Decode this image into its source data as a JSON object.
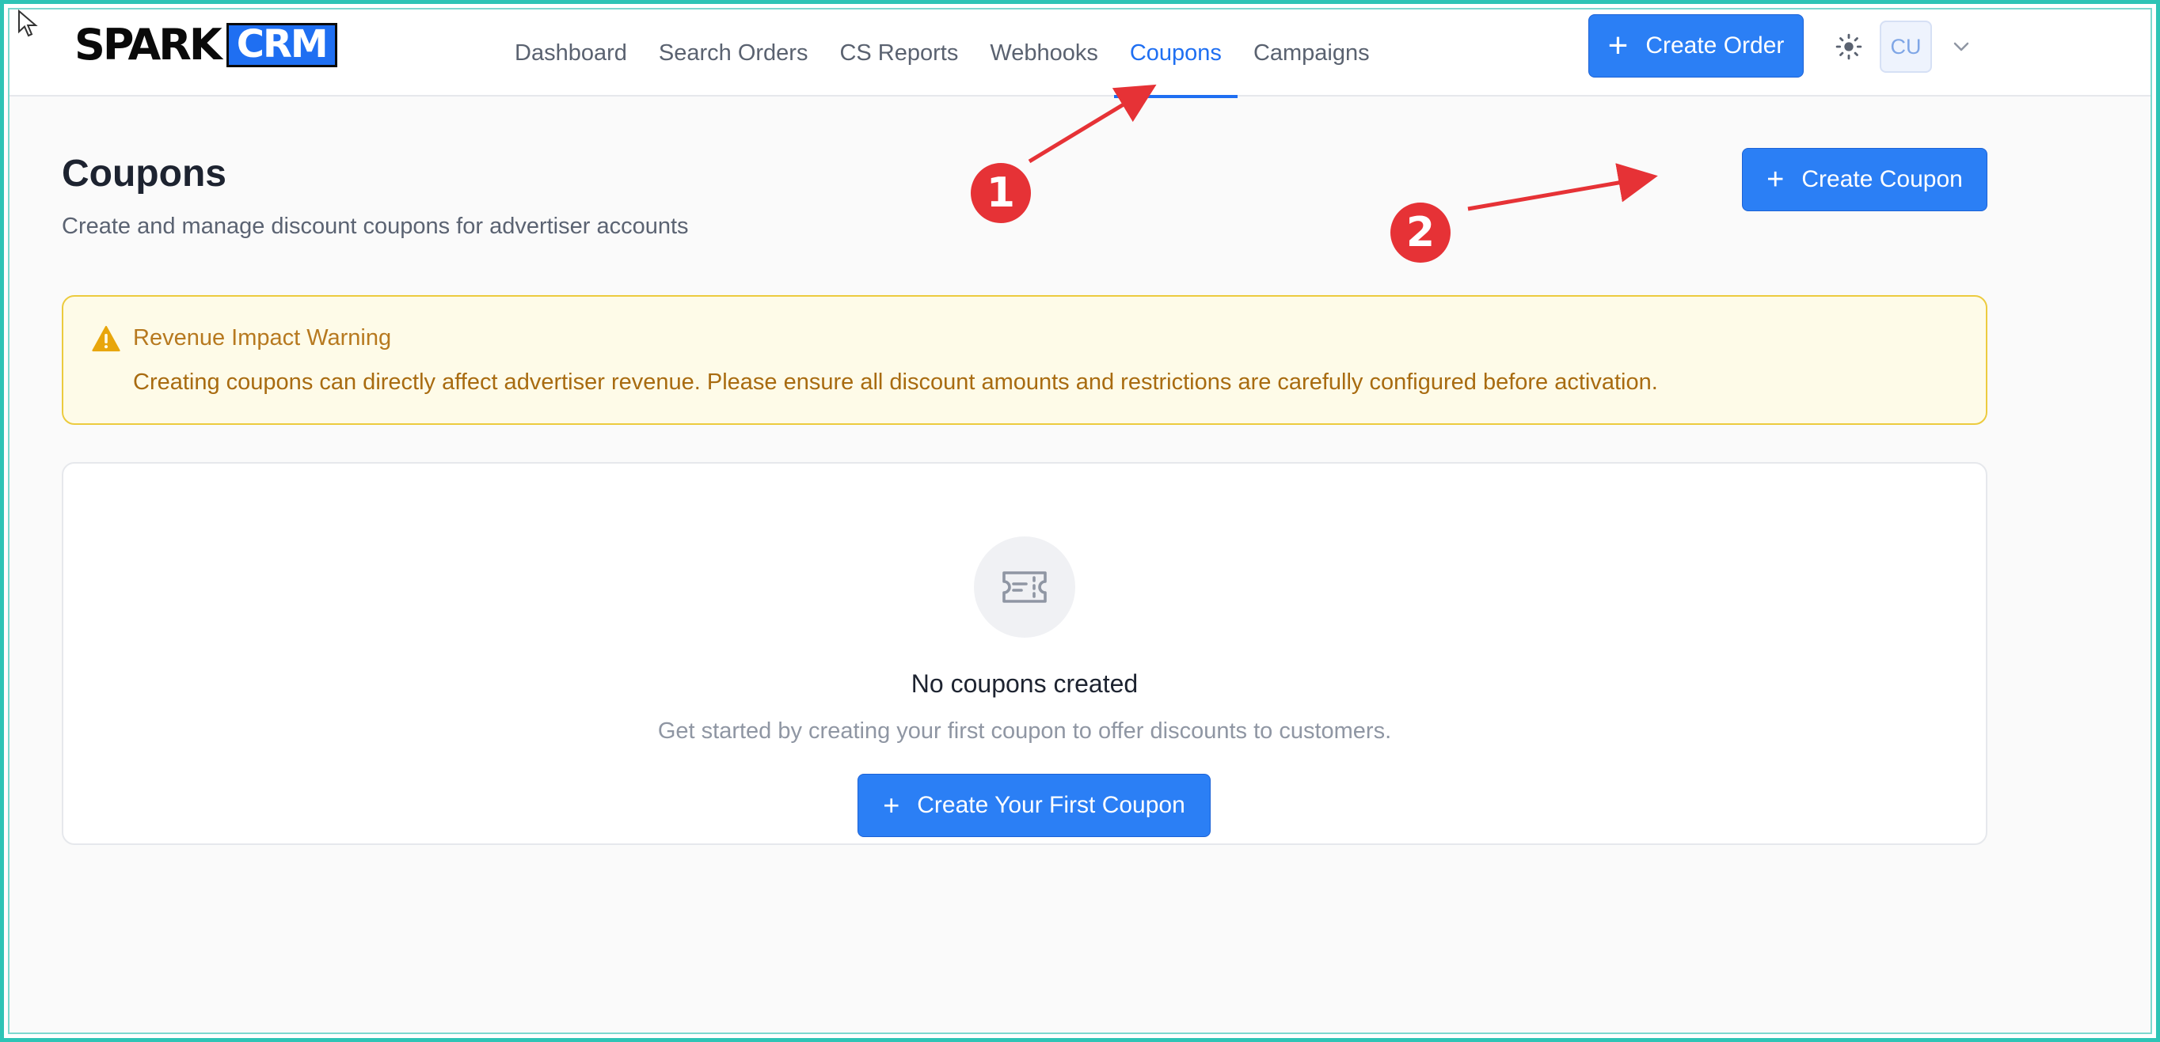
{
  "logo": {
    "spark": "SPARK",
    "crm": "CRM"
  },
  "nav": {
    "items": [
      {
        "label": "Dashboard",
        "active": false
      },
      {
        "label": "Search Orders",
        "active": false
      },
      {
        "label": "CS Reports",
        "active": false
      },
      {
        "label": "Webhooks",
        "active": false
      },
      {
        "label": "Coupons",
        "active": true
      },
      {
        "label": "Campaigns",
        "active": false
      }
    ]
  },
  "header": {
    "create_order_label": "Create Order",
    "avatar_initials": "CU",
    "theme_icon": "sun-icon"
  },
  "page": {
    "title": "Coupons",
    "subtitle": "Create and manage discount coupons for advertiser accounts",
    "create_coupon_label": "Create Coupon"
  },
  "warning": {
    "title": "Revenue Impact Warning",
    "text": "Creating coupons can directly affect advertiser revenue. Please ensure all discount amounts and restrictions are carefully configured before activation.",
    "icon": "warning-triangle-icon"
  },
  "empty_state": {
    "icon": "ticket-icon",
    "title": "No coupons created",
    "text": "Get started by creating your first coupon to offer discounts to customers.",
    "button_label": "Create Your First Coupon"
  },
  "annotations": {
    "badge_1": "1",
    "badge_2": "2"
  },
  "colors": {
    "primary": "#2b7ff5",
    "nav_active": "#1f6ff2",
    "warning_bg": "#fefbe8",
    "warning_border": "#eccb3e",
    "warning_text": "#a86b10",
    "annotation_red": "#e63236",
    "frame": "#2ec4b6"
  }
}
